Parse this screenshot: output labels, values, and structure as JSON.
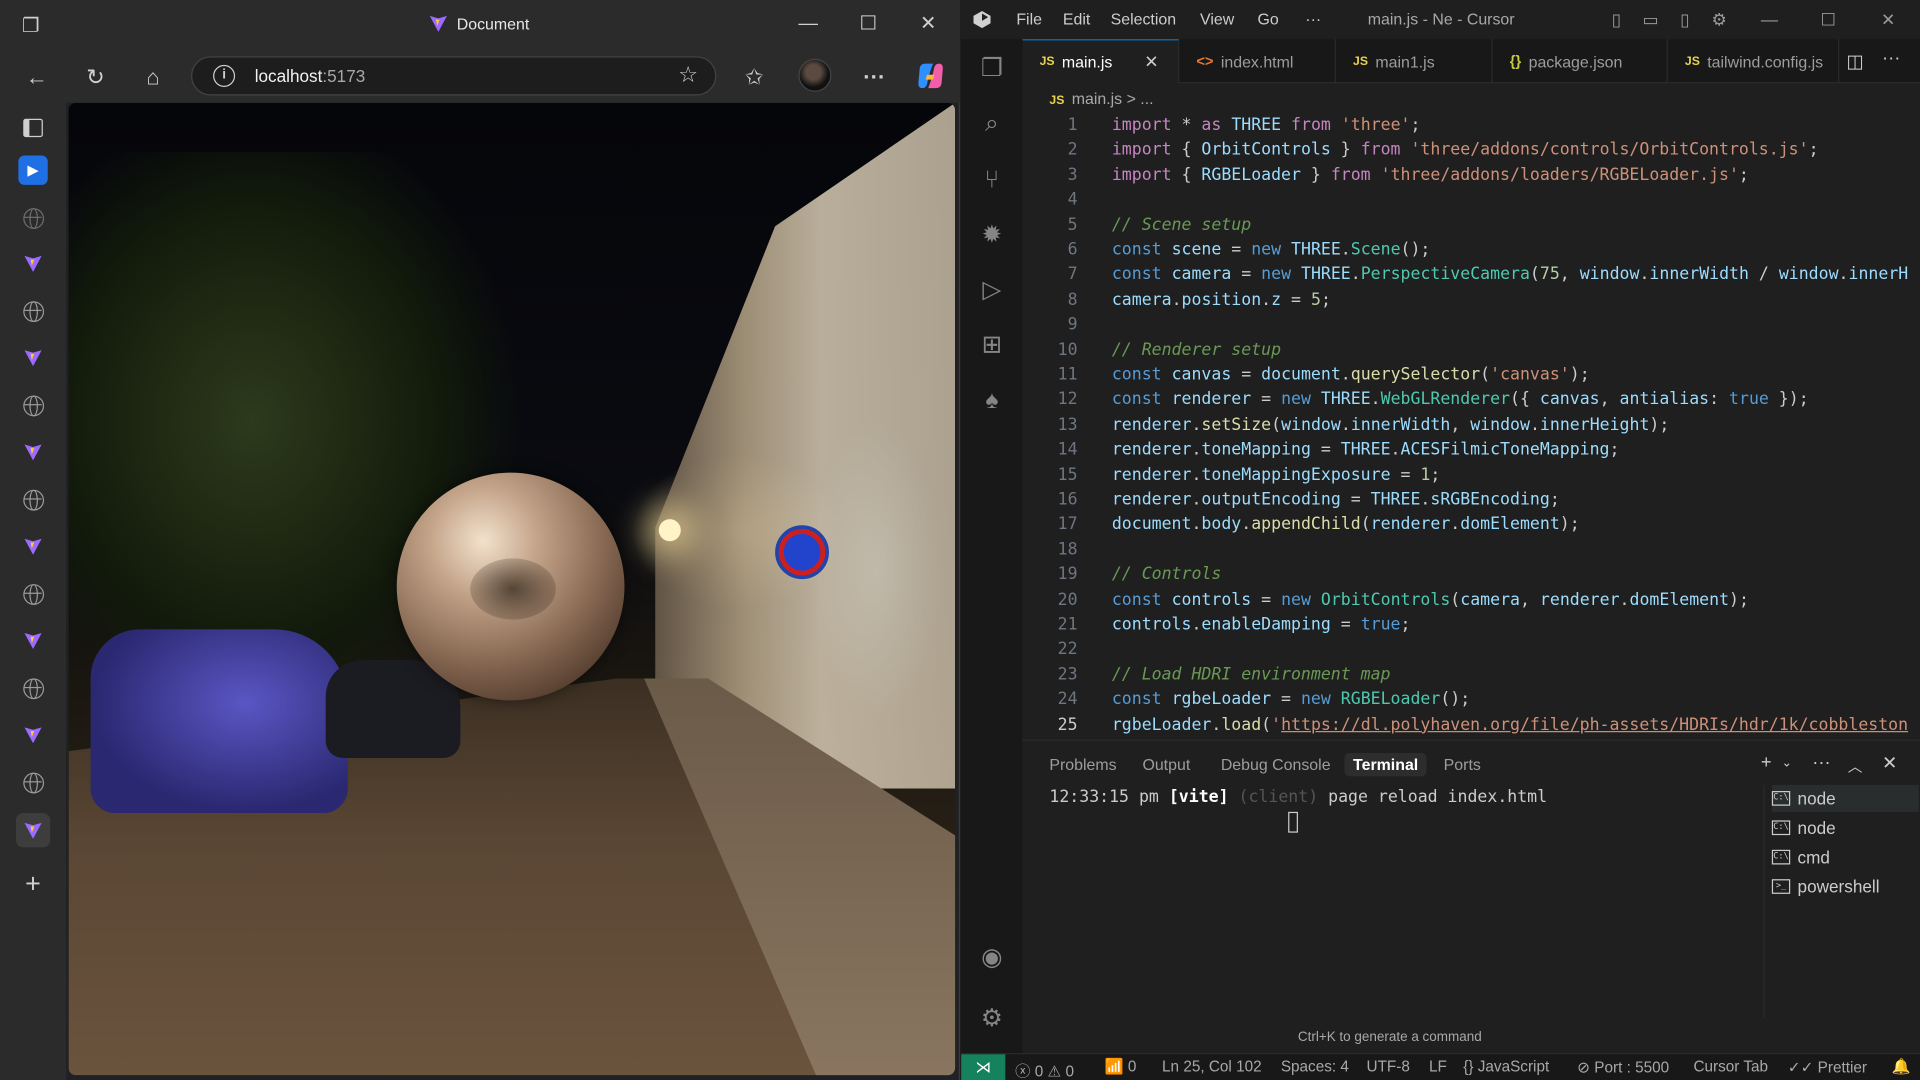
{
  "browser": {
    "title": "Document",
    "url_host": "localhost",
    "url_port": ":5173",
    "sidebar_icons": [
      "sidebar-toggle-icon",
      "play-icon",
      "globe-icon",
      "vite-icon",
      "globe-icon",
      "vite-icon",
      "globe-icon",
      "vite-icon",
      "globe-icon",
      "vite-icon",
      "globe-icon",
      "vite-icon",
      "globe-icon",
      "vite-icon",
      "globe-icon",
      "vite-icon",
      "add-icon"
    ]
  },
  "editor": {
    "menu": [
      "File",
      "Edit",
      "Selection",
      "View",
      "Go",
      "···"
    ],
    "window_title": "main.js - Ne - Cursor",
    "tabs": [
      {
        "label": "main.js",
        "icon": "JS",
        "active": true
      },
      {
        "label": "index.html",
        "icon": "<>"
      },
      {
        "label": "main1.js",
        "icon": "JS"
      },
      {
        "label": "package.json",
        "icon": "{}"
      },
      {
        "label": "tailwind.config.js",
        "icon": "JS"
      }
    ],
    "breadcrumb": {
      "file": "main.js",
      "sep": "> ..."
    },
    "current_line": 25,
    "line_numbers": [
      "1",
      "2",
      "3",
      "4",
      "5",
      "6",
      "7",
      "8",
      "9",
      "10",
      "11",
      "12",
      "13",
      "14",
      "15",
      "16",
      "17",
      "18",
      "19",
      "20",
      "21",
      "22",
      "23",
      "24",
      "25"
    ]
  },
  "panel": {
    "tabs": [
      "Problems",
      "Output",
      "Debug Console",
      "Terminal",
      "Ports"
    ],
    "active_tab": "Terminal",
    "terminal": {
      "time": "12:33:15 pm",
      "tag": "[vite]",
      "client": "(client)",
      "message": "page reload index.html"
    },
    "terminals": [
      "node",
      "node",
      "cmd",
      "powershell"
    ],
    "hint": "Ctrl+K to generate a command"
  },
  "status": {
    "errors": "0",
    "warnings": "0",
    "ports_count": "0",
    "position": "Ln 25, Col 102",
    "spaces": "Spaces: 4",
    "encoding": "UTF-8",
    "eol": "LF",
    "language": "JavaScript",
    "port": "Port : 5500",
    "cursor_tab": "Cursor Tab",
    "prettier": "Prettier"
  },
  "colors": {
    "accent": "#0078d4",
    "remote": "#16825d",
    "js_icon": "#e8d44d"
  }
}
